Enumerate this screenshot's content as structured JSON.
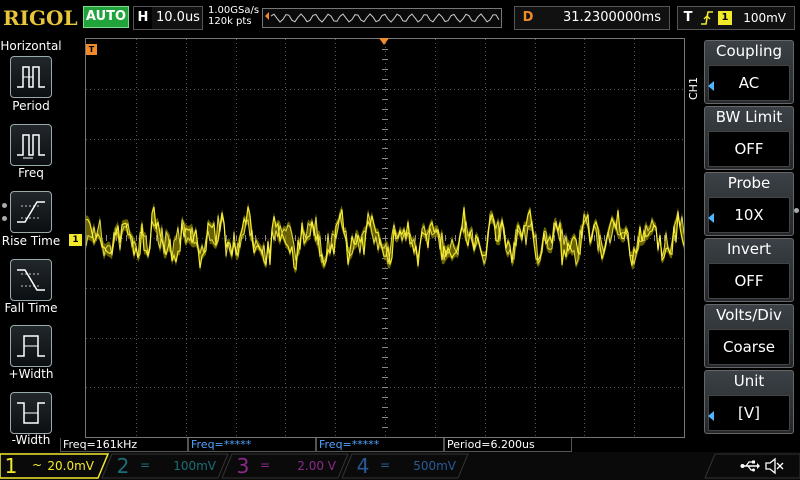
{
  "brand": "RIGOL",
  "run_mode": "AUTO",
  "horizontal": {
    "tag": "H",
    "timebase": "10.0us"
  },
  "sample_rate": "1.00GSa/s",
  "memory_depth": "120k pts",
  "delay": {
    "tag": "D",
    "value": "31.2300000ms"
  },
  "trigger": {
    "tag": "T",
    "source": "1",
    "level": "100mV",
    "edge_icon": "rising-edge-icon"
  },
  "left_panel": {
    "title": "Horizontal",
    "items": [
      {
        "label": "Period",
        "icon": "period-icon"
      },
      {
        "label": "Freq",
        "icon": "freq-icon"
      },
      {
        "label": "Rise Time",
        "icon": "rise-time-icon"
      },
      {
        "label": "Fall Time",
        "icon": "fall-time-icon"
      },
      {
        "label": "+Width",
        "icon": "positive-width-icon"
      },
      {
        "label": "-Width",
        "icon": "negative-width-icon"
      }
    ]
  },
  "waveform_markers": {
    "trigger_pos": "T",
    "ch1_ground": "1"
  },
  "right_menu": {
    "channel": "CH1",
    "items": [
      {
        "title": "Coupling",
        "value": "AC",
        "arrow": true
      },
      {
        "title": "BW Limit",
        "value": "OFF",
        "arrow": false
      },
      {
        "title": "Probe",
        "value": "10X",
        "arrow": true
      },
      {
        "title": "Invert",
        "value": "OFF",
        "arrow": false
      },
      {
        "title": "Volts/Div",
        "value": "Coarse",
        "arrow": false
      },
      {
        "title": "Unit",
        "value": "[V]",
        "arrow": true
      }
    ]
  },
  "measurements": [
    {
      "text": "Freq=161kHz",
      "color": "#ffffff"
    },
    {
      "text": "Freq=*****",
      "color": "#4fa3ff"
    },
    {
      "text": "Freq=*****",
      "color": "#4fa3ff"
    },
    {
      "text": "Period=6.200us",
      "color": "#ffffff"
    }
  ],
  "channels": [
    {
      "num": "1",
      "coupling": "~",
      "scale": "20.0mV",
      "color": "#f2e92a",
      "active": true
    },
    {
      "num": "2",
      "coupling": "=",
      "scale": "100mV",
      "color": "#27b5c8",
      "active": false
    },
    {
      "num": "3",
      "coupling": "=",
      "scale": "2.00 V",
      "color": "#d43ad4",
      "active": false
    },
    {
      "num": "4",
      "coupling": "=",
      "scale": "500mV",
      "color": "#3a7fd4",
      "active": false
    }
  ],
  "status_icons": [
    "usb-icon",
    "sound-mute-icon"
  ],
  "colors": {
    "ch1": "#f2e92a",
    "accent": "#f08a2a",
    "auto": "#21a33b"
  }
}
